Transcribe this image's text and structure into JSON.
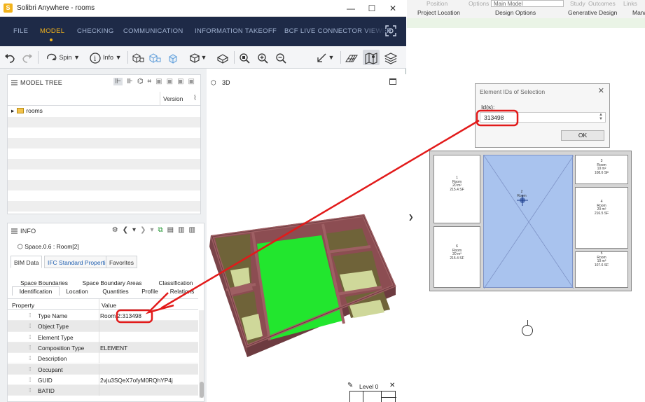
{
  "window": {
    "title": "Solibri Anywhere - rooms",
    "app_letter": "S",
    "min": "—",
    "max": "☐",
    "close": "✕"
  },
  "menu": {
    "items": [
      "FILE",
      "MODEL",
      "CHECKING",
      "COMMUNICATION",
      "INFORMATION TAKEOFF",
      "BCF LIVE CONNECTOR VIEWER"
    ],
    "active": "MODEL"
  },
  "toolbar": {
    "spin_label": "Spin",
    "info_label": "Info"
  },
  "model_tree": {
    "title": "MODEL TREE",
    "col_version": "Version",
    "root_item": "rooms"
  },
  "info": {
    "title": "INFO",
    "selection": "Space.0.6 : Room[2]",
    "tabs": [
      "BIM Data",
      "IFC Standard Properties",
      "Favorites"
    ],
    "subtabs_row1": [
      "Space Boundaries",
      "Space Boundary Areas",
      "Classification"
    ],
    "subtabs_row2": [
      "Identification",
      "Location",
      "Quantities",
      "Profile",
      "Relations"
    ],
    "col_property": "Property",
    "col_value": "Value",
    "rows": [
      {
        "key": "Type Name",
        "value": "Room 2:313498"
      },
      {
        "key": "Object Type",
        "value": ""
      },
      {
        "key": "Element Type",
        "value": ""
      },
      {
        "key": "Composition Type",
        "value": "ELEMENT"
      },
      {
        "key": "Description",
        "value": ""
      },
      {
        "key": "Occupant",
        "value": ""
      },
      {
        "key": "GUID",
        "value": "2vju3SQeX7ofyM0RQhYP4j"
      },
      {
        "key": "BATID",
        "value": ""
      }
    ]
  },
  "view3d": {
    "title": "3D",
    "level": "Level 0"
  },
  "revit": {
    "position_label": "Position",
    "options_label": "Options",
    "main_model": "Main Model",
    "study_label": "Study",
    "outcomes_label": "Outcomes",
    "links_label": "Links",
    "project_location": "Project Location",
    "design_options": "Design Options",
    "generative_design": "Generative Design",
    "manage_cut": "Mana"
  },
  "dialog": {
    "title": "Element IDs of Selection",
    "label": "Id(s):",
    "value": "313498",
    "ok": "OK"
  },
  "plan": {
    "rooms": [
      {
        "num": "1",
        "name": "Room",
        "area1": "20 m²",
        "area2": "215.4 SF"
      },
      {
        "num": "2",
        "name": "Room",
        "area1": "",
        "area2": ""
      },
      {
        "num": "3",
        "name": "Room",
        "area1": "10 m²",
        "area2": "108.6 SF"
      },
      {
        "num": "4",
        "name": "Room",
        "area1": "20 m²",
        "area2": "216.5 SF"
      },
      {
        "num": "5",
        "name": "Room",
        "area1": "10 m²",
        "area2": "107.6 SF"
      },
      {
        "num": "6",
        "name": "Room",
        "area1": "20 m²",
        "area2": "215.4 SF"
      }
    ]
  },
  "colors": {
    "menu_bg": "#1e2a47",
    "menu_active": "#f2b31b",
    "selected_room_3d": "#22e62e",
    "walls_3d": "#9e5f63",
    "annotation": "#e21a1a",
    "selected_room_plan": "#a9c3ee"
  }
}
